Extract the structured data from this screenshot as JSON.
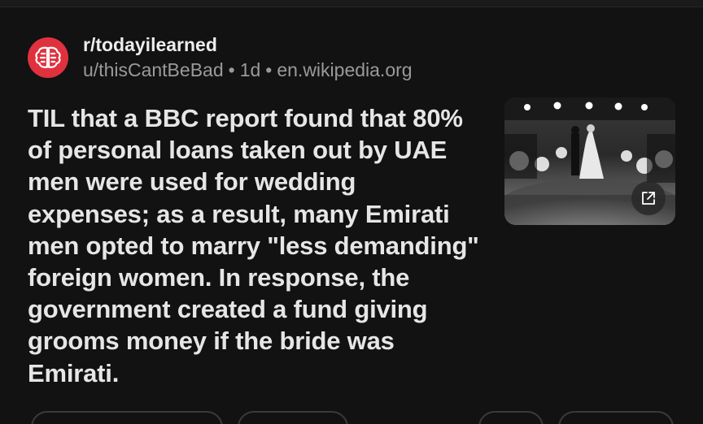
{
  "post": {
    "subreddit": "r/todayilearned",
    "author": "u/thisCantBeBad",
    "age": "1d",
    "domain": "en.wikipedia.org",
    "separator": "•",
    "title": "TIL that a BBC report found that 80% of personal loans taken out by UAE men were used for wedding expenses; as a result, many Emirati men opted to marry \"less demanding\" foreign women. In response, the government created a fund giving grooms money if the bride was Emirati.",
    "thumbnail_icon": "external-link-icon",
    "subreddit_icon": "brain-icon"
  },
  "colors": {
    "background": "#121212",
    "avatar": "#e0323e",
    "title_text": "#e6e6e6",
    "meta_text": "#9a9a9a"
  }
}
